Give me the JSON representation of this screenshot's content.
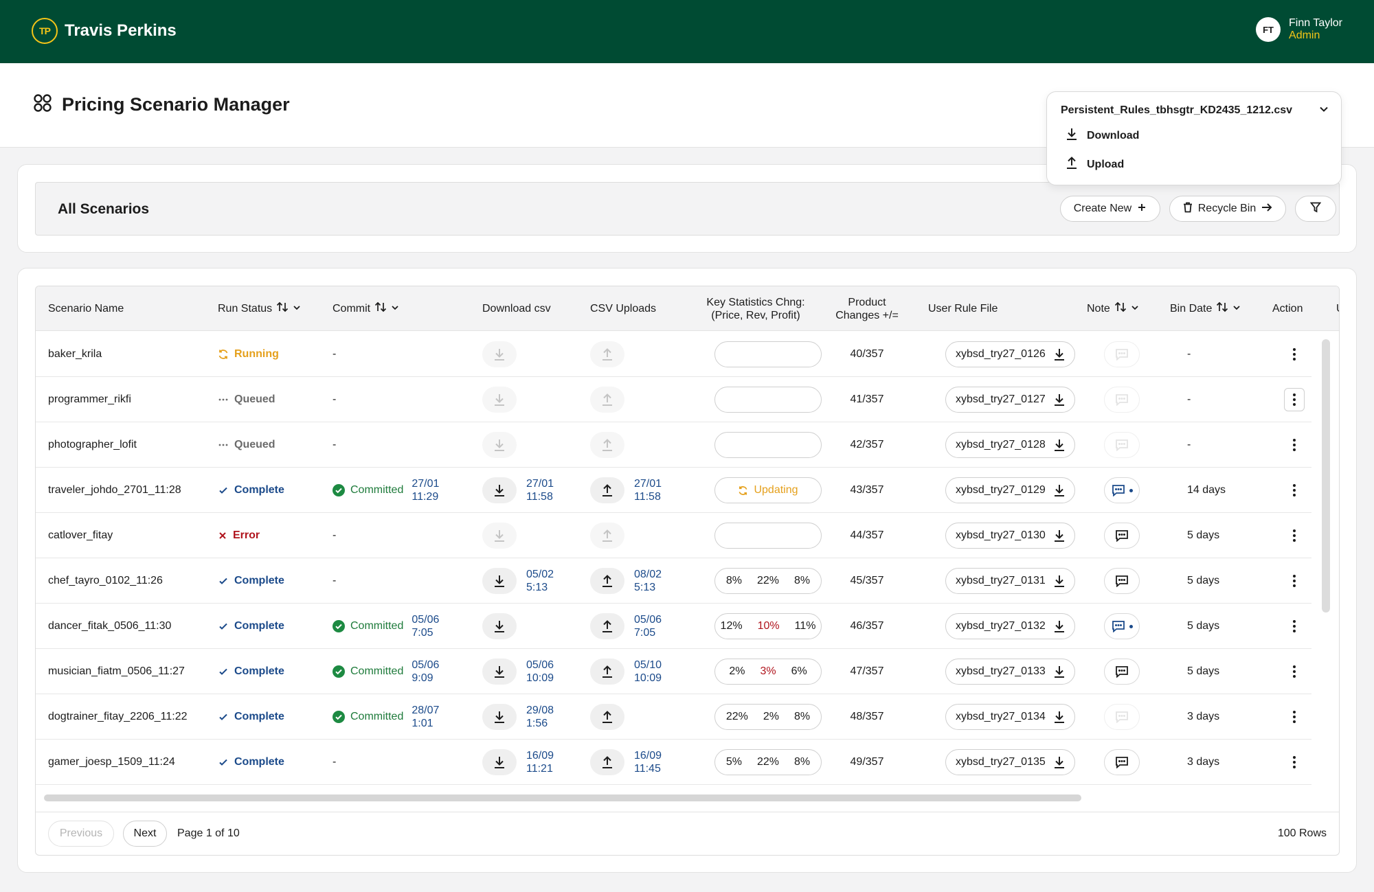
{
  "topbar": {
    "brand_mark": "TP",
    "brand_name": "Travis Perkins",
    "user_initials": "FT",
    "user_name": "Finn Taylor",
    "user_role": "Admin",
    "colors": {
      "bar": "#004b33",
      "accent": "#f5c518"
    }
  },
  "page": {
    "title": "Pricing Scenario Manager"
  },
  "file_menu": {
    "filename": "Persistent_Rules_tbhsgtr_KD2435_1212.csv",
    "download_label": "Download",
    "upload_label": "Upload"
  },
  "scenarios_header": {
    "title": "All Scenarios",
    "create_label": "Create New",
    "recycle_label": "Recycle Bin"
  },
  "table": {
    "columns": {
      "name": "Scenario Name",
      "run_status": "Run Status",
      "commit": "Commit",
      "download": "Download csv",
      "uploads": "CSV Uploads",
      "stats": "Key Statistics Chng: (Price, Rev, Profit)",
      "changes": "Product Changes +/=",
      "rule_file": "User Rule File",
      "note": "Note",
      "bin_date": "Bin Date",
      "action": "Action",
      "overflow": "U"
    },
    "rows": [
      {
        "name": "baker_krila",
        "status": "Running",
        "status_type": "running",
        "commit": "-",
        "commit_date": "",
        "dl_date": "",
        "ul_date": "",
        "stats": [],
        "updating": "",
        "changes": "40/357",
        "file": "xybsd_try27_0126",
        "note": "faint",
        "bin": "-",
        "dl_enabled": false,
        "ul_enabled": false
      },
      {
        "name": "programmer_rikfi",
        "status": "Queued",
        "status_type": "queued",
        "commit": "-",
        "commit_date": "",
        "dl_date": "",
        "ul_date": "",
        "stats": [],
        "updating": "",
        "changes": "41/357",
        "file": "xybsd_try27_0127",
        "note": "faint",
        "bin": "-",
        "dl_enabled": false,
        "ul_enabled": false
      },
      {
        "name": "photographer_lofit",
        "status": "Queued",
        "status_type": "queued",
        "commit": "-",
        "commit_date": "",
        "dl_date": "",
        "ul_date": "",
        "stats": [],
        "updating": "",
        "changes": "42/357",
        "file": "xybsd_try27_0128",
        "note": "faint",
        "bin": "-",
        "dl_enabled": false,
        "ul_enabled": false
      },
      {
        "name": "traveler_johdo_2701_11:28",
        "status": "Complete",
        "status_type": "complete",
        "commit": "Committed",
        "commit_date": "27/01\n11:29",
        "dl_date": "27/01\n11:58",
        "ul_date": "27/01\n11:58",
        "stats": [],
        "updating": "Updating",
        "changes": "43/357",
        "file": "xybsd_try27_0129",
        "note": "new",
        "bin": "14 days",
        "dl_enabled": true,
        "ul_enabled": true
      },
      {
        "name": "catlover_fitay",
        "status": "Error",
        "status_type": "error",
        "commit": "-",
        "commit_date": "",
        "dl_date": "",
        "ul_date": "",
        "stats": [],
        "updating": "",
        "changes": "44/357",
        "file": "xybsd_try27_0130",
        "note": "normal",
        "bin": "5 days",
        "dl_enabled": false,
        "ul_enabled": false
      },
      {
        "name": "chef_tayro_0102_11:26",
        "status": "Complete",
        "status_type": "complete",
        "commit": "-",
        "commit_date": "",
        "dl_date": "05/02\n5:13",
        "ul_date": "08/02\n5:13",
        "stats": [
          "8%",
          "22%",
          "8%"
        ],
        "stats_red": [],
        "updating": "",
        "changes": "45/357",
        "file": "xybsd_try27_0131",
        "note": "normal",
        "bin": "5 days",
        "dl_enabled": true,
        "ul_enabled": true
      },
      {
        "name": "dancer_fitak_0506_11:30",
        "status": "Complete",
        "status_type": "complete",
        "commit": "Committed",
        "commit_date": "05/06\n7:05",
        "dl_date": "",
        "ul_date": "05/06\n7:05",
        "stats": [
          "12%",
          "10%",
          "11%"
        ],
        "stats_red": [
          1
        ],
        "updating": "",
        "changes": "46/357",
        "file": "xybsd_try27_0132",
        "note": "new",
        "bin": "5 days",
        "dl_enabled": true,
        "ul_enabled": true
      },
      {
        "name": "musician_fiatm_0506_11:27",
        "status": "Complete",
        "status_type": "complete",
        "commit": "Committed",
        "commit_date": "05/06\n9:09",
        "dl_date": "05/06\n10:09",
        "ul_date": "05/10\n10:09",
        "stats": [
          "2%",
          "3%",
          "6%"
        ],
        "stats_red": [
          1
        ],
        "updating": "",
        "changes": "47/357",
        "file": "xybsd_try27_0133",
        "note": "normal",
        "bin": "5 days",
        "dl_enabled": true,
        "ul_enabled": true
      },
      {
        "name": "dogtrainer_fitay_2206_11:22",
        "status": "Complete",
        "status_type": "complete",
        "commit": "Committed",
        "commit_date": "28/07\n1:01",
        "dl_date": "29/08\n1:56",
        "ul_date": "",
        "stats": [
          "22%",
          "2%",
          "8%"
        ],
        "stats_red": [],
        "updating": "",
        "changes": "48/357",
        "file": "xybsd_try27_0134",
        "note": "faint",
        "bin": "3 days",
        "dl_enabled": true,
        "ul_enabled": true
      },
      {
        "name": "gamer_joesp_1509_11:24",
        "status": "Complete",
        "status_type": "complete",
        "commit": "-",
        "commit_date": "",
        "dl_date": "16/09\n11:21",
        "ul_date": "16/09\n11:45",
        "stats": [
          "5%",
          "22%",
          "8%"
        ],
        "stats_red": [],
        "updating": "",
        "changes": "49/357",
        "file": "xybsd_try27_0135",
        "note": "normal",
        "bin": "3 days",
        "dl_enabled": true,
        "ul_enabled": true
      }
    ]
  },
  "pager": {
    "previous_label": "Previous",
    "next_label": "Next",
    "page_text": "Page 1 of 10",
    "rows_text": "100 Rows"
  }
}
